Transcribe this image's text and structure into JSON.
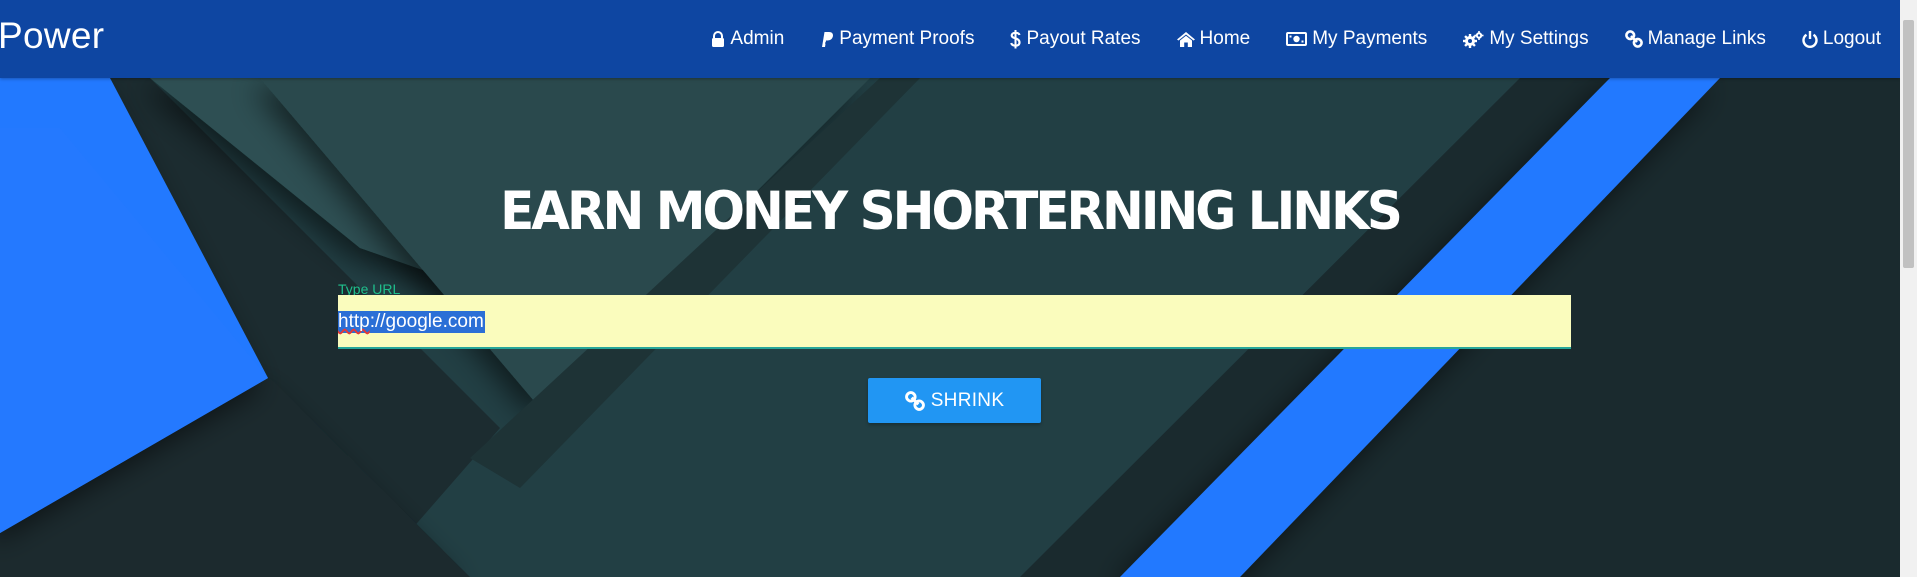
{
  "brand": "Power",
  "nav": [
    {
      "label": "Admin",
      "icon": "lock-icon"
    },
    {
      "label": "Payment Proofs",
      "icon": "paypal-icon"
    },
    {
      "label": "Payout Rates",
      "icon": "dollar-icon"
    },
    {
      "label": "Home",
      "icon": "home-icon"
    },
    {
      "label": "My Payments",
      "icon": "money-icon"
    },
    {
      "label": "My Settings",
      "icon": "gears-icon"
    },
    {
      "label": "Manage Links",
      "icon": "link-icon"
    },
    {
      "label": "Logout",
      "icon": "power-icon"
    }
  ],
  "hero": {
    "title": "EARN MONEY SHORTERNING LINKS",
    "url_label": "Type URL",
    "url_value_prefix": "http",
    "url_value_rest": "://google.com",
    "button_label": "SHRINK",
    "button_icon": "link-icon"
  },
  "colors": {
    "navbar": "#0e46a2",
    "background": "#223f44",
    "accent_blue": "#2479ff",
    "button": "#2196f3",
    "input_bg": "#fafcbd",
    "label": "#1fbf8c"
  }
}
